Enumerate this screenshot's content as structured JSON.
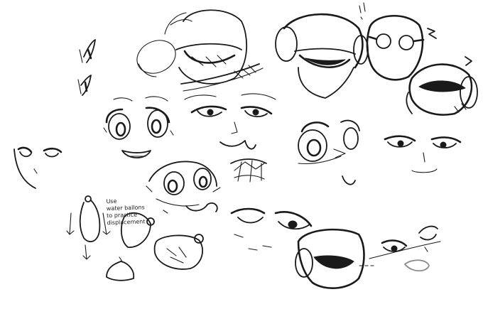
{
  "note": {
    "lines": [
      "Use",
      "water ballons",
      "to practice",
      "displacement"
    ]
  },
  "colors": {
    "ink": "#1a1a1a",
    "paper": "#ffffff"
  }
}
